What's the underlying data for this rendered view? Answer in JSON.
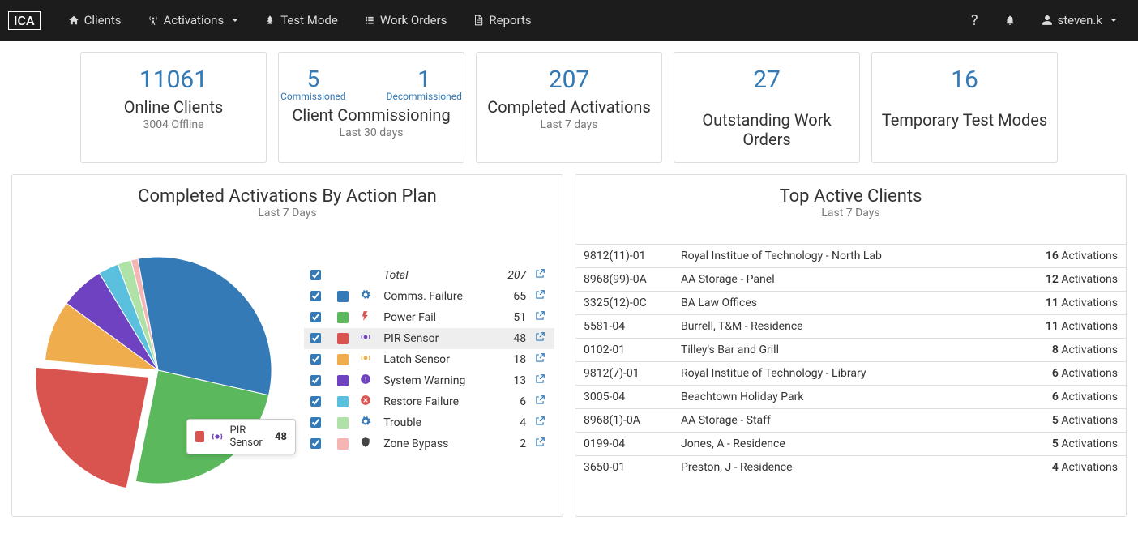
{
  "navbar": {
    "brand": "ICA",
    "items": [
      {
        "label": "Clients",
        "icon": "home-icon"
      },
      {
        "label": "Activations",
        "icon": "radio-tower-icon",
        "caret": true
      },
      {
        "label": "Test Mode",
        "icon": "tree-icon"
      },
      {
        "label": "Work Orders",
        "icon": "list-icon"
      },
      {
        "label": "Reports",
        "icon": "file-icon"
      }
    ],
    "user": "steven.k"
  },
  "cards": {
    "online": {
      "value": "11061",
      "title": "Online Clients",
      "sub": "3004 Offline"
    },
    "commissioning": {
      "commissioned": {
        "value": "5",
        "label": "Commissioned"
      },
      "decommissioned": {
        "value": "1",
        "label": "Decommissioned"
      },
      "title": "Client Commissioning",
      "sub": "Last 30 days"
    },
    "activations": {
      "value": "207",
      "title": "Completed Activations",
      "sub": "Last 7 days"
    },
    "workorders": {
      "value": "27",
      "title": "Outstanding Work Orders"
    },
    "testmodes": {
      "value": "16",
      "title": "Temporary Test Modes"
    }
  },
  "chart_data": {
    "type": "pie",
    "title": "Completed Activations By Action Plan",
    "subtitle": "Last 7 Days",
    "total_label": "Total",
    "total": 207,
    "series": [
      {
        "name": "Comms. Failure",
        "value": 65,
        "color": "#337ab7",
        "iconColor": "#337ab7"
      },
      {
        "name": "Power Fail",
        "value": 51,
        "color": "#5cb85c",
        "iconColor": "#d9534f"
      },
      {
        "name": "PIR Sensor",
        "value": 48,
        "color": "#d9534f",
        "iconColor": "#6f42c1",
        "highlight": true,
        "offset": 14
      },
      {
        "name": "Latch Sensor",
        "value": 18,
        "color": "#f0ad4e",
        "iconColor": "#f0ad4e"
      },
      {
        "name": "System Warning",
        "value": 13,
        "color": "#6f42c1",
        "iconColor": "#6f42c1"
      },
      {
        "name": "Restore Failure",
        "value": 6,
        "color": "#5bc0de",
        "iconColor": "#d9534f"
      },
      {
        "name": "Trouble",
        "value": 4,
        "color": "#aee2a6",
        "iconColor": "#337ab7"
      },
      {
        "name": "Zone Bypass",
        "value": 2,
        "color": "#f5b5b5",
        "iconColor": "#444"
      }
    ],
    "tooltip": {
      "name": "PIR Sensor",
      "value": "48",
      "color": "#d9534f"
    }
  },
  "top_clients": {
    "title": "Top Active Clients",
    "subtitle": "Last 7 Days",
    "suffix": "Activations",
    "rows": [
      {
        "code": "9812(11)-01",
        "name": "Royal Institue of Technology - North Lab",
        "count": "16"
      },
      {
        "code": "8968(99)-0A",
        "name": "AA Storage - Panel",
        "count": "12"
      },
      {
        "code": "3325(12)-0C",
        "name": "BA Law Offices",
        "count": "11"
      },
      {
        "code": "5581-04",
        "name": "Burrell, T&M - Residence",
        "count": "11"
      },
      {
        "code": "0102-01",
        "name": "Tilley's Bar and Grill",
        "count": "8"
      },
      {
        "code": "9812(7)-01",
        "name": "Royal Institue of Technology - Library",
        "count": "6"
      },
      {
        "code": "3005-04",
        "name": "Beachtown Holiday Park",
        "count": "6"
      },
      {
        "code": "8968(1)-0A",
        "name": "AA Storage - Staff",
        "count": "5"
      },
      {
        "code": "0199-04",
        "name": "Jones, A - Residence",
        "count": "5"
      },
      {
        "code": "3650-01",
        "name": "Preston, J - Residence",
        "count": "4"
      }
    ]
  }
}
